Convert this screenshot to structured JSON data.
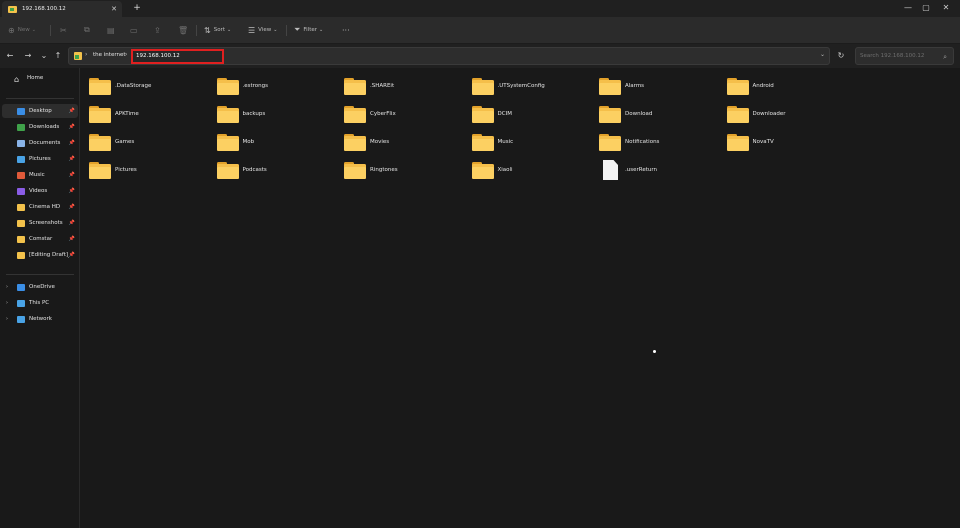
{
  "window": {
    "tab_title": "192.168.100.12",
    "tab_close": "✕",
    "new_tab": "+",
    "minimize": "—",
    "maximize": "▢",
    "close": "✕"
  },
  "toolbar": {
    "new_label": "New",
    "sort_label": "Sort",
    "view_label": "View",
    "filter_label": "Filter",
    "more_label": "···"
  },
  "nav": {
    "back": "←",
    "forward": "→",
    "recent": "⌄",
    "up": "↑"
  },
  "address": {
    "crumb": "the internet",
    "current": "192.168.100.12",
    "dropdown": "⌄",
    "refresh": "↻"
  },
  "search": {
    "placeholder": "Search 192.168.100.12"
  },
  "sidebar": {
    "home": "Home",
    "pinned": [
      {
        "label": "Desktop",
        "color": "#3a8ee6",
        "selected": true
      },
      {
        "label": "Downloads",
        "color": "#3fa24a"
      },
      {
        "label": "Documents",
        "color": "#8ab4e8"
      },
      {
        "label": "Pictures",
        "color": "#49a3e6"
      },
      {
        "label": "Music",
        "color": "#e05a3a"
      },
      {
        "label": "Videos",
        "color": "#8a5ce6"
      },
      {
        "label": "Cinema HD",
        "color": "#f3c24b"
      },
      {
        "label": "Screenshots",
        "color": "#f3c24b"
      },
      {
        "label": "Comstar",
        "color": "#f3c24b"
      },
      {
        "label": "[Editing Draft]_ES Fi",
        "color": "#f3c24b"
      }
    ],
    "locations": [
      {
        "label": "OneDrive",
        "color": "#3a8ee6"
      },
      {
        "label": "This PC",
        "color": "#49a3e6"
      },
      {
        "label": "Network",
        "color": "#49a3e6"
      }
    ]
  },
  "items": [
    {
      "name": ".DataStorage",
      "kind": "folder"
    },
    {
      "name": ".estrongs",
      "kind": "folder"
    },
    {
      "name": ".SHAREit",
      "kind": "folder"
    },
    {
      "name": ".UTSystemConfig",
      "kind": "folder"
    },
    {
      "name": "Alarms",
      "kind": "folder"
    },
    {
      "name": "Android",
      "kind": "folder"
    },
    {
      "name": "APKTime",
      "kind": "folder"
    },
    {
      "name": "backups",
      "kind": "folder"
    },
    {
      "name": "CyberFlix",
      "kind": "folder"
    },
    {
      "name": "DCIM",
      "kind": "folder"
    },
    {
      "name": "Download",
      "kind": "folder"
    },
    {
      "name": "Downloader",
      "kind": "folder"
    },
    {
      "name": "Games",
      "kind": "folder"
    },
    {
      "name": "Mob",
      "kind": "folder"
    },
    {
      "name": "Movies",
      "kind": "folder"
    },
    {
      "name": "Music",
      "kind": "folder"
    },
    {
      "name": "Notifications",
      "kind": "folder"
    },
    {
      "name": "NovaTV",
      "kind": "folder"
    },
    {
      "name": "Pictures",
      "kind": "folder"
    },
    {
      "name": "Podcasts",
      "kind": "folder"
    },
    {
      "name": "Ringtones",
      "kind": "folder"
    },
    {
      "name": "Xiaoli",
      "kind": "folder"
    },
    {
      "name": ".userReturn",
      "kind": "file"
    }
  ]
}
